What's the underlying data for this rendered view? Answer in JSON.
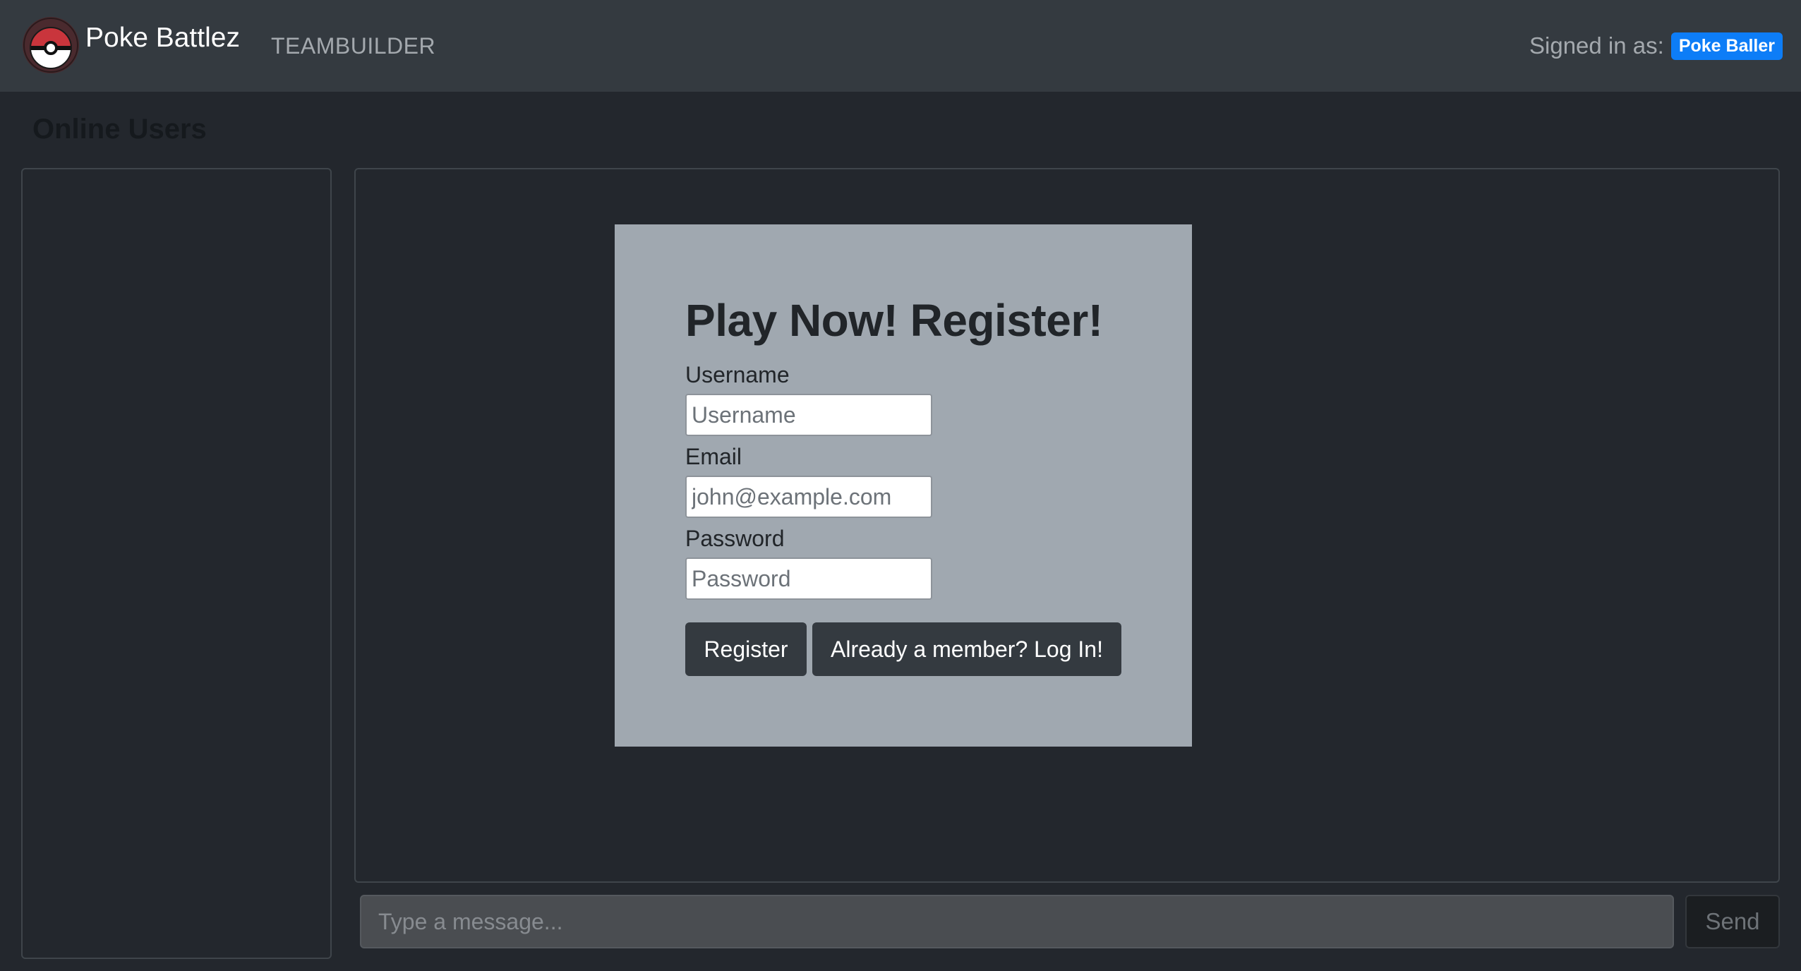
{
  "navbar": {
    "brand_name": "Poke Battlez",
    "logo_icon": "pokeball-icon",
    "links": [
      {
        "label": "TEAMBUILDER"
      }
    ],
    "signed_in_label": "Signed in as:",
    "user_name": "Poke Baller"
  },
  "sidebar": {
    "title": "Online Users",
    "users": []
  },
  "register_form": {
    "title": "Play Now! Register!",
    "fields": [
      {
        "label": "Username",
        "placeholder": "Username",
        "value": ""
      },
      {
        "label": "Email",
        "placeholder": "john@example.com",
        "value": ""
      },
      {
        "label": "Password",
        "placeholder": "Password",
        "value": ""
      }
    ],
    "register_button": "Register",
    "login_button": "Already a member? Log In!"
  },
  "chat": {
    "message_placeholder": "Type a message...",
    "send_button": "Send"
  },
  "colors": {
    "page_background": "#23272d",
    "navbar_background": "#343a40",
    "card_background": "#a0a8b0",
    "badge_background": "#0d7df7",
    "button_dark": "#343a40"
  }
}
